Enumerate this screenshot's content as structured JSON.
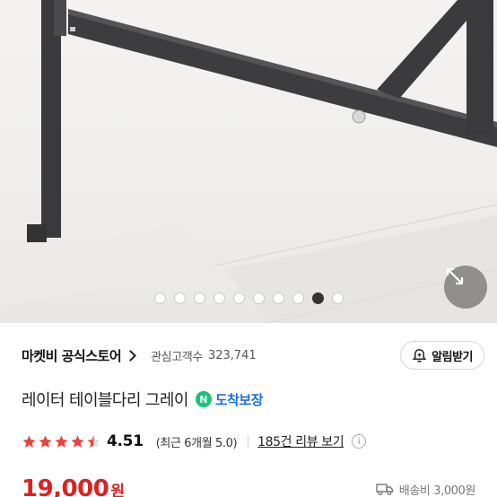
{
  "carousel": {
    "dots_total": 10,
    "active_index": 8
  },
  "store": {
    "name": "마켓비 공식스토어",
    "followers_label": "관심고객수",
    "followers_count": "323,741",
    "notify_label": "알림받기"
  },
  "product": {
    "title": "레이터 테이블다리 그레이",
    "badge_letter": "N",
    "badge_text": "도착보장"
  },
  "rating": {
    "score": "4.51",
    "score_value": 4.51,
    "recent": "(최근 6개월 5.0)",
    "reviews_link": "185건 리뷰 보기",
    "info_symbol": "i"
  },
  "price": {
    "amount": "19,000",
    "currency": "원"
  },
  "shipping": {
    "text": "배송비 3,000원"
  },
  "colors": {
    "price": "#e02020",
    "star": "#e8433f",
    "badge_green": "#19c27b",
    "badge_blue": "#1e6fe0"
  },
  "icons": {
    "expand": "expand-arrows-icon",
    "notify": "bell-plus-icon",
    "shipping": "truck-icon"
  }
}
